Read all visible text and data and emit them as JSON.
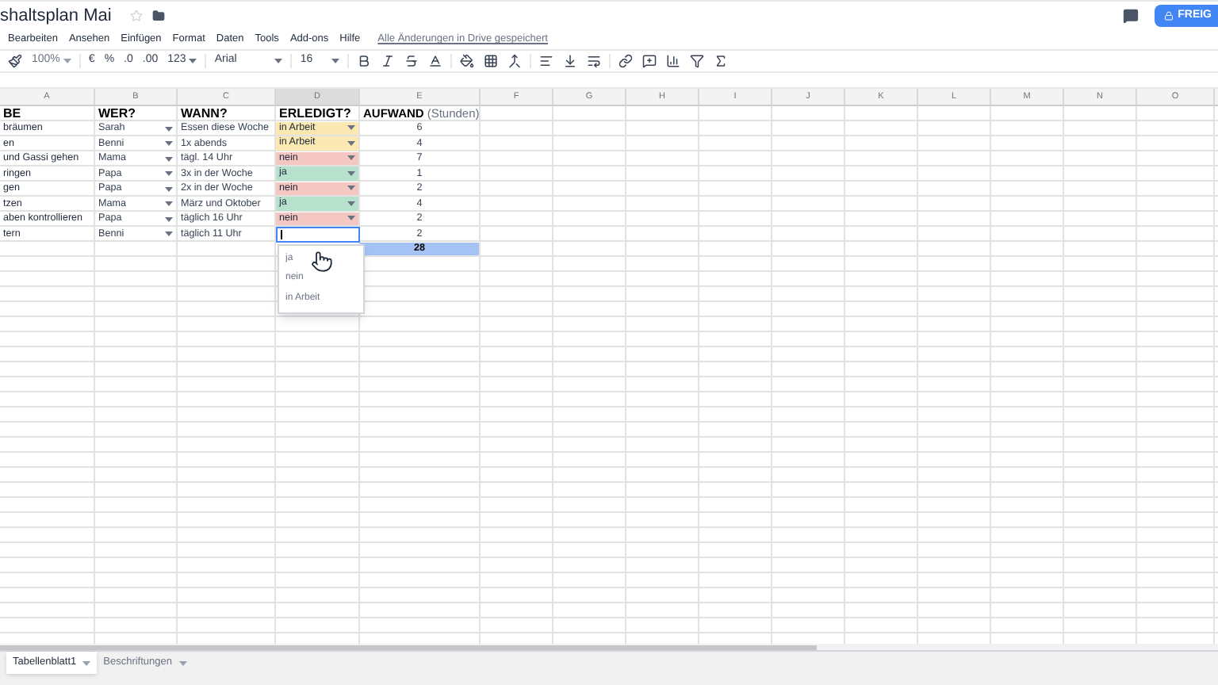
{
  "title": "shaltsplan Mai",
  "menu": {
    "items": [
      "Bearbeiten",
      "Ansehen",
      "Einfügen",
      "Format",
      "Daten",
      "Tools",
      "Add-ons",
      "Hilfe"
    ],
    "save_status": "Alle Änderungen in Drive gespeichert"
  },
  "share_button": "FREIG",
  "toolbar": {
    "zoom": "100%",
    "currency": "€",
    "percent": "%",
    "decimals_less": ".0",
    "decimals_more": ".00",
    "number_format": "123",
    "font": "Arial",
    "font_size": "16"
  },
  "columns": [
    "A",
    "B",
    "C",
    "D",
    "E",
    "F",
    "G",
    "H",
    "I",
    "J",
    "K",
    "L",
    "M",
    "N",
    "O"
  ],
  "header_row": {
    "task": "BE",
    "who": "WER?",
    "when": "WANN?",
    "status": "ERLEDIGT?",
    "hours": "AUFWAND",
    "hours_unit": "(Stunden)"
  },
  "rows": [
    {
      "task": "bräumen",
      "who": "Sarah",
      "when": "Essen diese Woche",
      "status": {
        "text": "in Arbeit",
        "color": "#fce8b2"
      },
      "editing": false,
      "hours": "6"
    },
    {
      "task": "en",
      "who": "Benni",
      "when": "1x abends",
      "status": {
        "text": "in Arbeit",
        "color": "#fce8b2"
      },
      "editing": false,
      "hours": "4"
    },
    {
      "task": "und Gassi gehen",
      "who": "Mama",
      "when": "tägl. 14 Uhr",
      "status": {
        "text": "nein",
        "color": "#f4c7c3"
      },
      "editing": false,
      "hours": "7"
    },
    {
      "task": "ringen",
      "who": "Papa",
      "when": "3x in der Woche",
      "status": {
        "text": "ja",
        "color": "#b7e1cd"
      },
      "editing": false,
      "hours": "1"
    },
    {
      "task": "gen",
      "who": "Papa",
      "when": "2x in der Woche",
      "status": {
        "text": "nein",
        "color": "#f4c7c3"
      },
      "editing": false,
      "hours": "2"
    },
    {
      "task": "tzen",
      "who": "Mama",
      "when": "März und Oktober",
      "status": {
        "text": "ja",
        "color": "#b7e1cd"
      },
      "editing": false,
      "hours": "4"
    },
    {
      "task": "aben kontrollieren",
      "who": "Papa",
      "when": "täglich 16 Uhr",
      "status": {
        "text": "nein",
        "color": "#f4c7c3"
      },
      "editing": false,
      "hours": "2"
    },
    {
      "task": "tern",
      "who": "Benni",
      "when": "täglich 11 Uhr",
      "status": null,
      "editing": true,
      "hours": "2"
    }
  ],
  "total": "28",
  "dropdown_options": [
    "ja",
    "nein",
    "in Arbeit"
  ],
  "sheets": [
    {
      "name": "Tabellenblatt1",
      "selected": true
    },
    {
      "name": "Beschriftungen",
      "selected": false
    }
  ]
}
